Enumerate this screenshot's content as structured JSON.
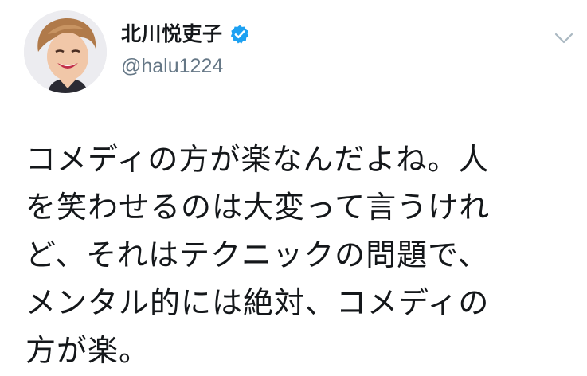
{
  "tweet": {
    "author": {
      "display_name": "北川悦吏子",
      "handle": "@halu1224",
      "verified": true,
      "verified_color": "#1da1f2"
    },
    "text_lines": [
      "コメディの方が楽なんだよね。人",
      "を笑わせるのは大変って言うけれ",
      "ど、それはテクニックの問題で、",
      "メンタル的には絶対、コメディの",
      "方が楽。"
    ],
    "icons": {
      "avatar": "profile-photo",
      "verified": "verified-badge-icon",
      "menu": "chevron-down-icon"
    },
    "colors": {
      "text": "#14171a",
      "secondary": "#657786",
      "caret": "#aab8c2"
    }
  }
}
